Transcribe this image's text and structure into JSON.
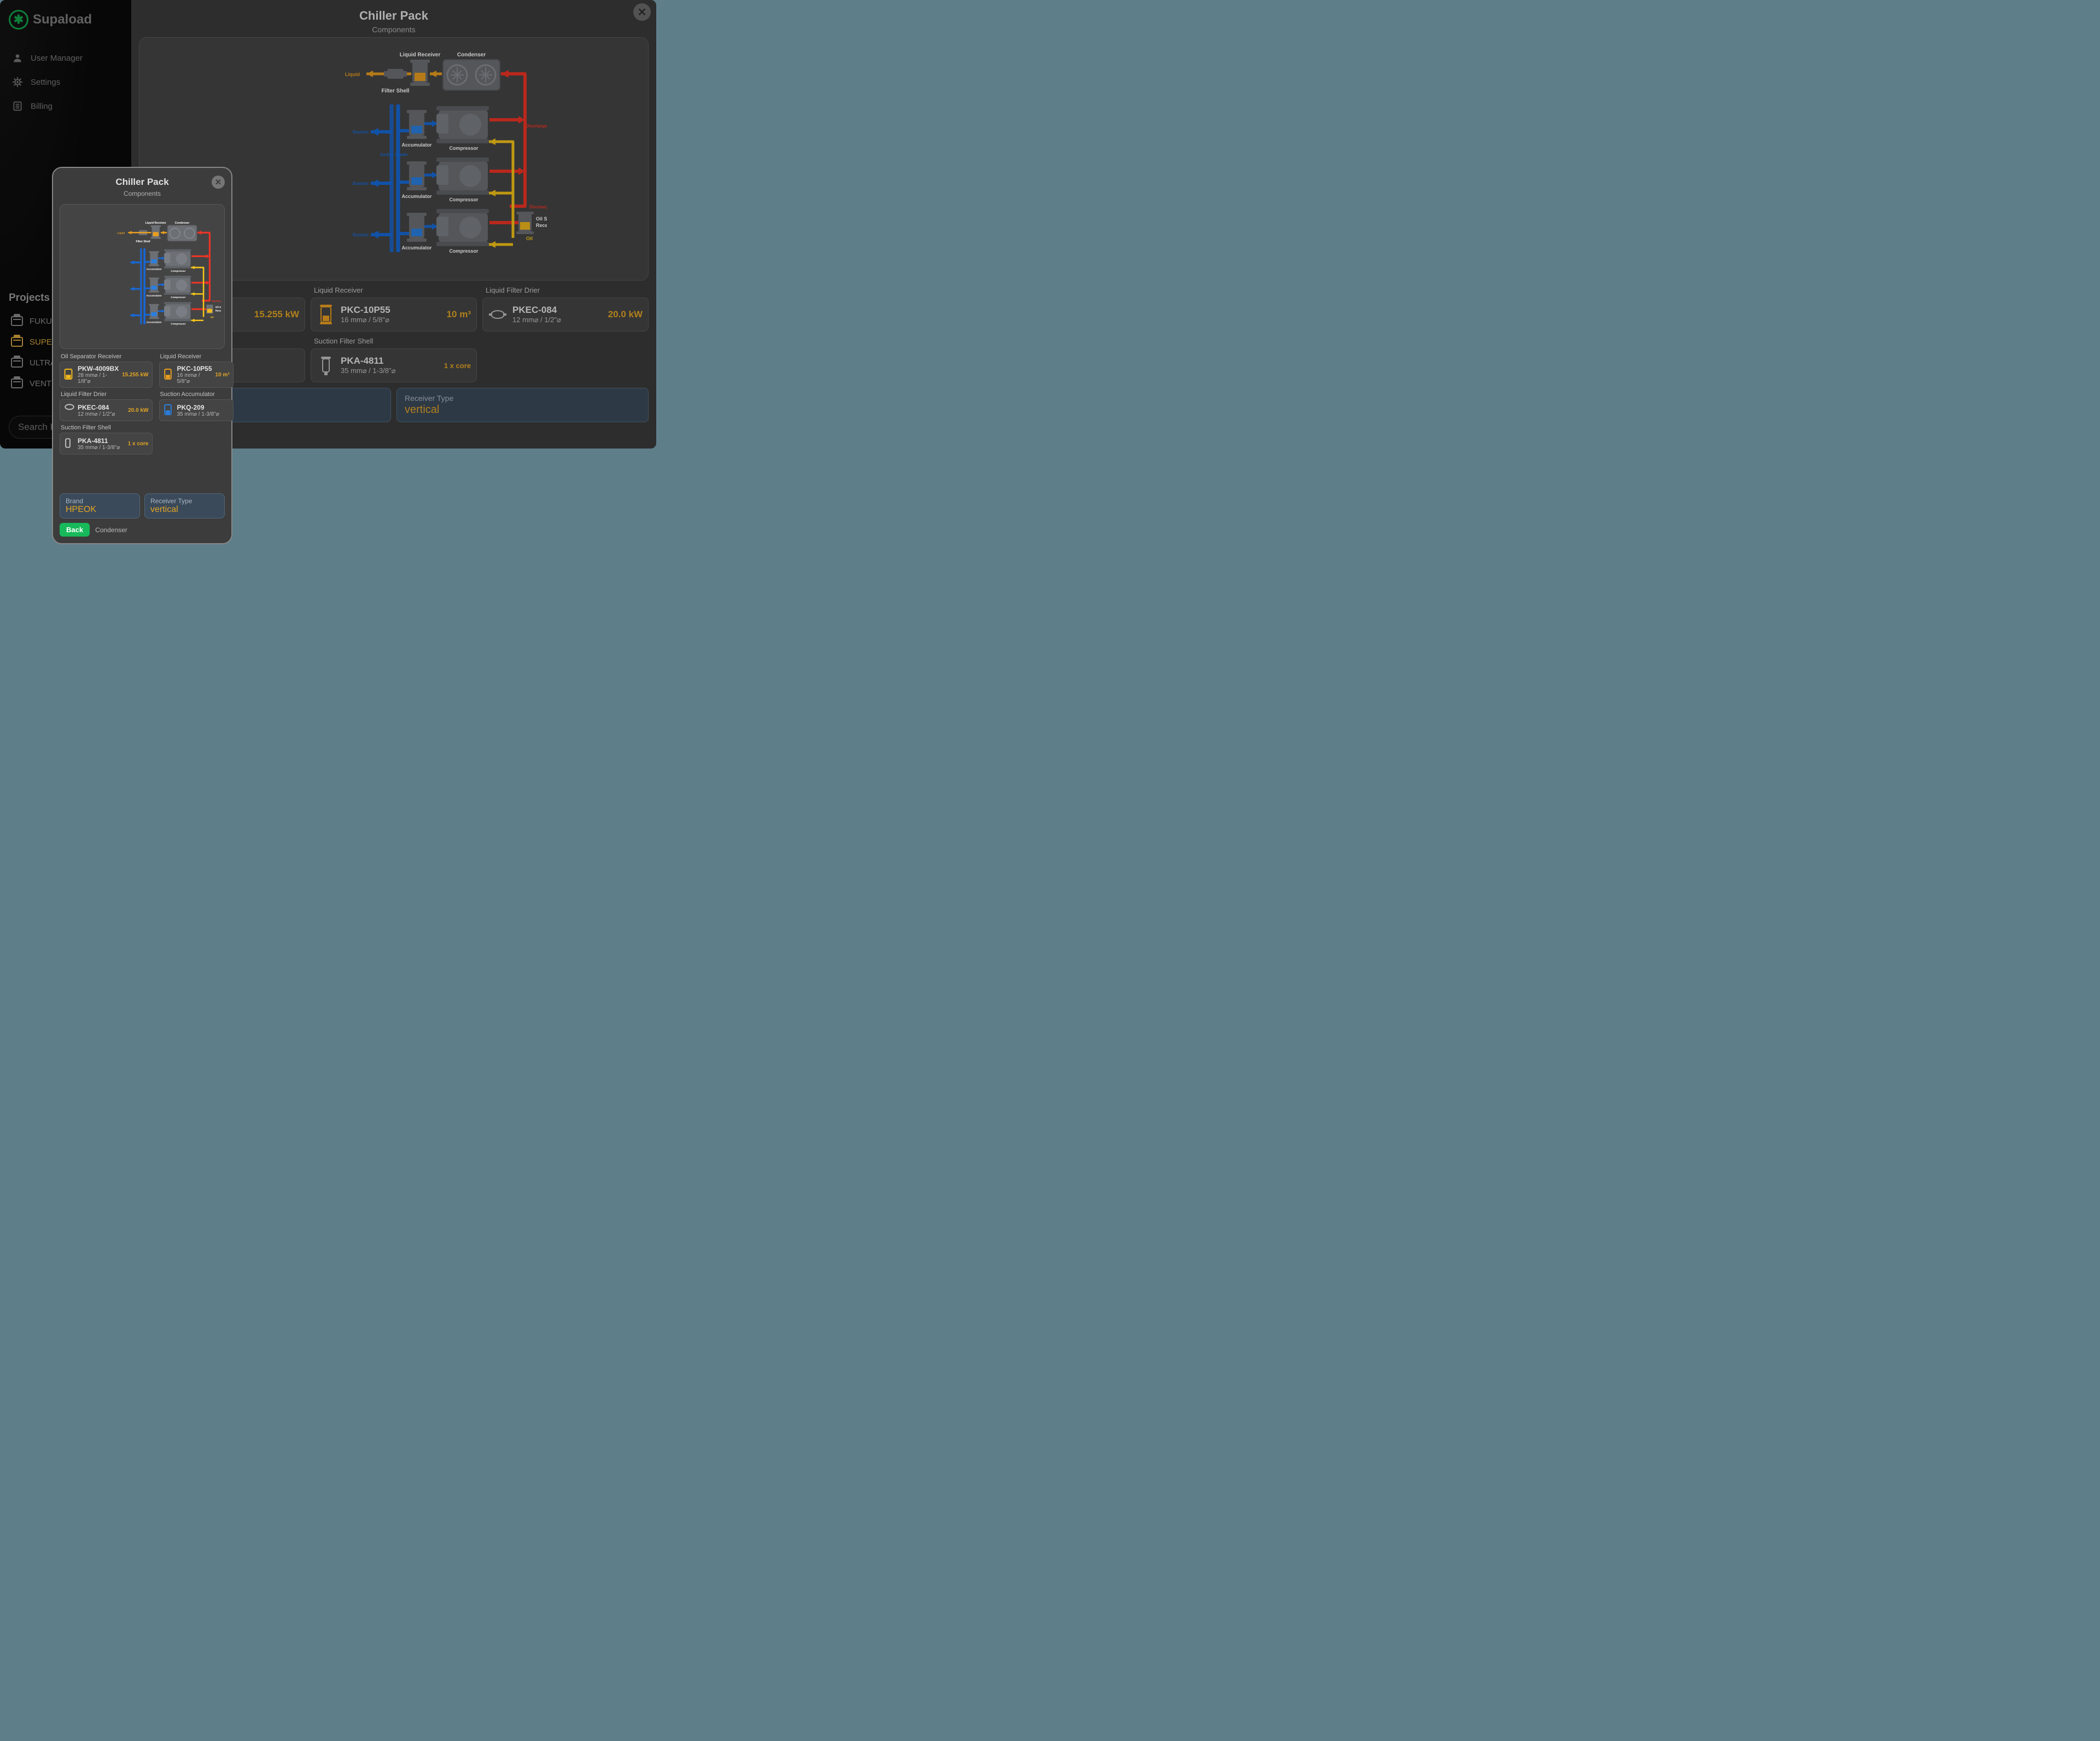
{
  "brand": {
    "name": "Supaload"
  },
  "nav": {
    "items": [
      {
        "label": "User Manager",
        "icon": "person"
      },
      {
        "label": "Settings",
        "icon": "gear"
      },
      {
        "label": "Billing",
        "icon": "ledger"
      }
    ]
  },
  "projects": {
    "heading": "Projects",
    "items": [
      {
        "label": "FUKUS",
        "active": false
      },
      {
        "label": "SUPER",
        "active": true
      },
      {
        "label": "ULTRA",
        "active": false
      },
      {
        "label": "VENTE",
        "active": false
      }
    ]
  },
  "search": {
    "placeholder": "Search Pr"
  },
  "modal": {
    "title": "Chiller Pack",
    "subtitle": "Components",
    "diagram_labels": {
      "liquid": "Liquid",
      "liquid_receiver": "Liquid Receiver",
      "filter_shell": "Filter Shell",
      "condenser": "Condenser",
      "accumulator": "Accumulator",
      "compressor": "Compressor",
      "suction": "Suction",
      "suction_header": "Suction Header",
      "discharge_header": "Discharge Header",
      "discharge": "Discharge",
      "oil": "Oil",
      "oil_separator_receiver": "Oil Separator\nReceiver"
    },
    "components": [
      {
        "key": "oil_separator_receiver",
        "label": "Oil Separator Receiver",
        "title": "PKW-4009BX",
        "sub": "28 mm⌀ / 1-1/8\"⌀",
        "metric": "15.255 kW",
        "icon": "oil-separator"
      },
      {
        "key": "liquid_receiver",
        "label": "Liquid Receiver",
        "title": "PKC-10P55",
        "sub": "16 mm⌀ / 5/8\"⌀",
        "metric": "10 m³",
        "icon": "liquid-receiver"
      },
      {
        "key": "liquid_filter_drier",
        "label": "Liquid Filter Drier",
        "title": "PKEC-084",
        "sub": "12 mm⌀ / 1/2\"⌀",
        "metric": "20.0 kW",
        "icon": "filter-drier"
      },
      {
        "key": "suction_accumulator",
        "label": "Suction Accumulator",
        "title": "PKQ-209",
        "sub": "35 mm⌀ / 1-3/8\"⌀",
        "metric": "",
        "icon": "accumulator"
      },
      {
        "key": "suction_filter_shell",
        "label": "Suction Filter Shell",
        "title": "PKA-4811",
        "sub": "35 mm⌀ / 1-3/8\"⌀",
        "metric": "1 x core",
        "icon": "filter-shell"
      }
    ],
    "info": [
      {
        "label": "Brand",
        "value": "HPEOK"
      },
      {
        "label": "Receiver Type",
        "value": "vertical"
      }
    ]
  },
  "panel_sm": {
    "back_label": "Back",
    "crumb": "Condenser"
  }
}
